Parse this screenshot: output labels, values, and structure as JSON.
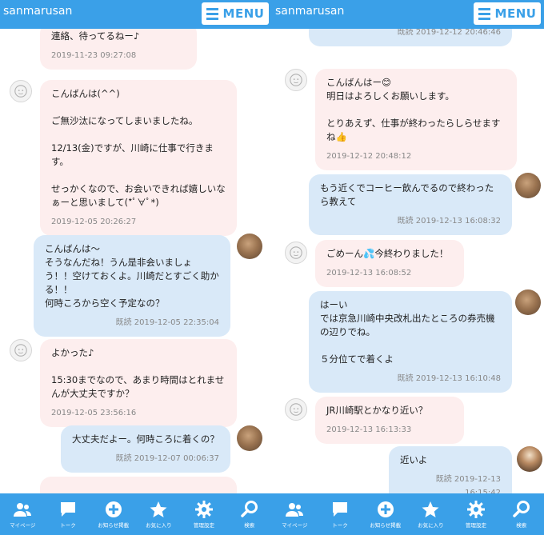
{
  "app_title": "sanmarusan",
  "menu_label": "MENU",
  "nav_items": [
    {
      "label": "マイページ",
      "icon": "people-icon"
    },
    {
      "label": "トーク",
      "icon": "speech-bubble-icon"
    },
    {
      "label": "お知らせ掲載",
      "icon": "plus-circle-icon"
    },
    {
      "label": "お気に入り",
      "icon": "star-icon"
    },
    {
      "label": "管理設定",
      "icon": "gear-icon"
    },
    {
      "label": "検索",
      "icon": "magnifier-icon"
    }
  ],
  "left_messages": [
    {
      "from": "them",
      "text": "連絡、待ってるねー♪",
      "meta": "2019-11-23 09:27:08"
    },
    {
      "from": "them",
      "text": "こんばんは(^^)\n\nご無沙汰になってしまいましたね。\n\n12/13(金)ですが、川崎に仕事で行きます。\n\nせっかくなので、お会いできれば嬉しいなぁーと思いまして(*ﾟ∀ﾟ*)",
      "meta": "2019-12-05 20:26:27"
    },
    {
      "from": "me",
      "text": "こんばんは～\nそうなんだね！うん是非会いましょう！！空けておくよ。川崎だとすごく助かる！！\n何時ころから空く予定なの？",
      "meta": "既読 2019-12-05 22:35:04"
    },
    {
      "from": "them",
      "text": "よかった♪\n\n15:30までなので、あまり時間はとれませんが大丈夫ですか？",
      "meta": "2019-12-05 23:56:16"
    },
    {
      "from": "me",
      "text": "大丈夫だよー。何時ころに着くの？",
      "meta": "既読 2019-12-07 00:06:37"
    }
  ],
  "right_messages": [
    {
      "from": "me",
      "text": "",
      "meta": "既読 2019-12-12 20:46:46"
    },
    {
      "from": "them",
      "text": "こんばんはー😊\n明日はよろしくお願いします。\n\nとりあえず、仕事が終わったらしらせますね👍",
      "meta": "2019-12-12 20:48:12"
    },
    {
      "from": "me",
      "text": "もう近くでコーヒー飲んでるので終わったら教えて",
      "meta": "既読 2019-12-13 16:08:32"
    },
    {
      "from": "them",
      "text": "ごめーん💦今終わりました！",
      "meta": "2019-12-13 16:08:52"
    },
    {
      "from": "me",
      "text": "はーい\nでは京急川崎中央改札出たところの券売機の辺りでね。\n\n５分位てで着くよ",
      "meta": "既読 2019-12-13 16:10:48"
    },
    {
      "from": "them",
      "text": "JR川崎駅とかなり近い？",
      "meta": "2019-12-13 16:13:33"
    },
    {
      "from": "me",
      "text": "近いよ",
      "meta": "既読 2019-12-13 16:15:42"
    }
  ],
  "colors": {
    "accent": "#3aa0e8",
    "bubble_in": "#fdeeee",
    "bubble_out": "#d9e9f8",
    "meta_text": "#888888"
  }
}
